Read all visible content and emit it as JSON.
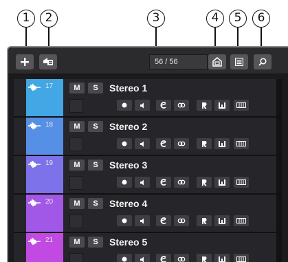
{
  "callouts": [
    "1",
    "2",
    "3",
    "4",
    "5",
    "6"
  ],
  "toolbar": {
    "counter": "56 / 56"
  },
  "tracks": [
    {
      "number": "17",
      "name": "Stereo 1",
      "color": "#42a7e4",
      "mute": "M",
      "solo": "S"
    },
    {
      "number": "18",
      "name": "Stereo 2",
      "color": "#568fe6",
      "mute": "M",
      "solo": "S"
    },
    {
      "number": "19",
      "name": "Stereo 3",
      "color": "#7d72ea",
      "mute": "M",
      "solo": "S"
    },
    {
      "number": "20",
      "name": "Stereo 4",
      "color": "#a258e6",
      "mute": "M",
      "solo": "S"
    },
    {
      "number": "21",
      "name": "Stereo 5",
      "color": "#c04ae2",
      "mute": "M",
      "solo": "S"
    }
  ],
  "icons": {
    "add": "plus-icon",
    "add_from_preset": "add-track-from-preset-icon",
    "fit": "fit-icon",
    "list": "list-icon",
    "search": "search-icon",
    "wave": "waveform-icon"
  }
}
